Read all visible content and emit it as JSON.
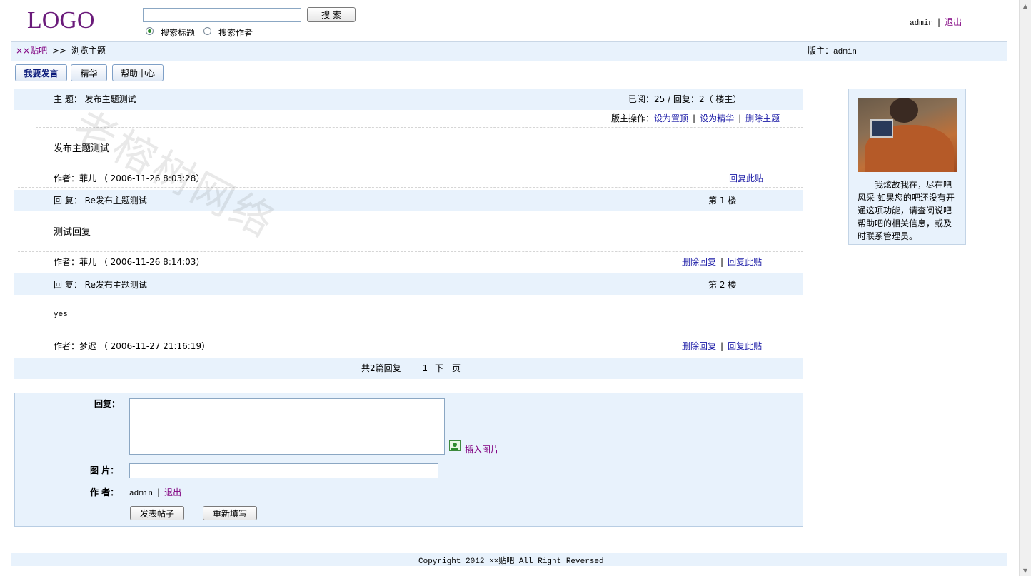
{
  "header": {
    "logo": "LOGO",
    "search_input_value": "",
    "search_button": "搜 索",
    "radio_title": "搜索标题",
    "radio_author": "搜索作者",
    "user": "admin",
    "logout": "退出"
  },
  "breadcrumb": {
    "home": "××贴吧",
    "separator": ">>",
    "current": "浏览主题",
    "moderator_label": "版主：",
    "moderator": "admin"
  },
  "tabs": {
    "post": "我要发言",
    "essence": "精华",
    "help": "帮助中心"
  },
  "topic": {
    "subject_label": "主 题：",
    "subject": "发布主题测试",
    "stats": "已阅：25 / 回复：2（ 楼主）",
    "mod_ops_label": "版主操作：",
    "set_top": "设为置顶",
    "set_essence": "设为精华",
    "delete_topic": "删除主题",
    "body": "发布主题测试",
    "author_line": "作者：菲儿 （ 2006-11-26 8:03:28）",
    "reply_this": "回复此贴"
  },
  "replies": [
    {
      "subject_label": "回 复：",
      "subject": "Re发布主题测试",
      "floor": "第 1 楼",
      "body": "测试回复",
      "author_line": "作者：菲儿 （ 2006-11-26 8:14:03）",
      "delete": "删除回复",
      "reply": "回复此贴"
    },
    {
      "subject_label": "回 复：",
      "subject": "Re发布主题测试",
      "floor": "第 2 楼",
      "body": "yes",
      "author_line": "作者：梦迟 （ 2006-11-27 21:16:19）",
      "delete": "删除回复",
      "reply": "回复此贴"
    }
  ],
  "pagination": {
    "summary": "共2篇回复",
    "page": "1",
    "next": "下一页"
  },
  "reply_form": {
    "reply_label": "回复：",
    "reply_value": "",
    "insert_image": "插入图片",
    "image_label": "图 片：",
    "image_value": "",
    "author_label": "作 者：",
    "author": "admin",
    "logout": "退出",
    "submit": "发表帖子",
    "reset": "重新填写"
  },
  "sidebar": {
    "text": "我炫故我在，尽在吧风采 如果您的吧还没有开通这项功能，请查阅说吧帮助吧的相关信息，或及时联系管理员。"
  },
  "footer": {
    "copyright": "Copyright 2012 ××贴吧 All Right Reversed"
  },
  "watermark": "老榕树网络",
  "colors": {
    "band": "#e8f2fc",
    "link": "#1a1aa6",
    "visited": "#800080"
  }
}
